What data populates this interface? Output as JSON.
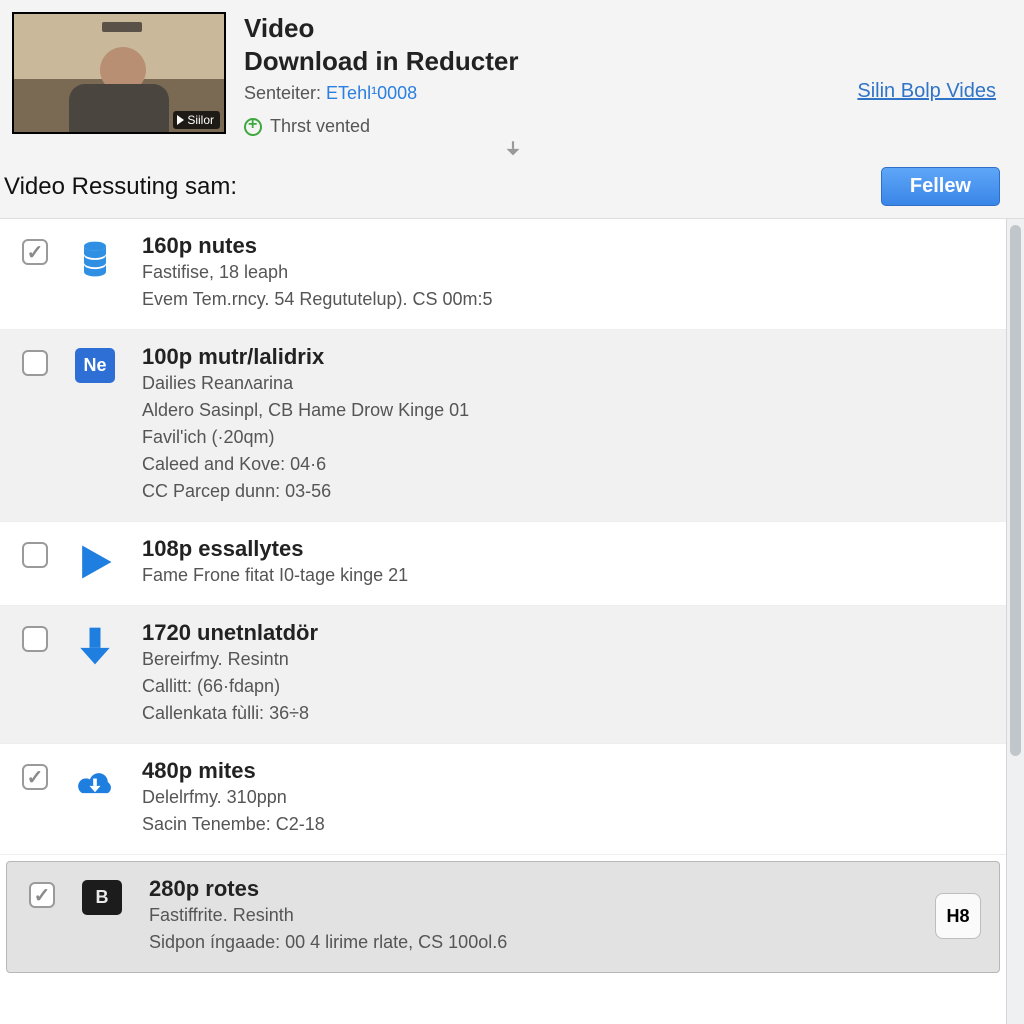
{
  "header": {
    "title_line1": "Video",
    "title_line2": "Download in Reducter",
    "sender_label": "Senteiter: ",
    "sender_link": "ETehl¹0008",
    "verified_text": "Thrst vented",
    "thumb_button": "Siilor",
    "sign_link": "Silin Bolp Vides"
  },
  "section": {
    "title": "Video Ressuting sam:",
    "follow_button": "Fellew"
  },
  "rows": [
    {
      "checked": true,
      "icon": "db-stack",
      "title": "160p nutes",
      "lines": [
        "Fastifise, 18 leaph",
        "Evem Tem.rncy. 54 Regututelup). CS 00m:5"
      ]
    },
    {
      "checked": false,
      "icon": "label-ne",
      "title": "100p mutr/lalidrix",
      "lines": [
        "Dailies Reanʌarina",
        "Aldero Sasinpl, CB  Hame Drow Kinge 01",
        "Favil'ich (·20qm)",
        "Caleed and Kove: 04·6",
        "CC Parcep dunn: 03-56"
      ]
    },
    {
      "checked": false,
      "icon": "play-tri",
      "title": "108p essallytes",
      "lines": [
        "Fame Frone fitat I0-tage kinge 21"
      ]
    },
    {
      "checked": false,
      "icon": "arrow-down",
      "title": "1720 unetnlatdör",
      "lines": [
        "Bereirfmy. Resintn",
        "Callitt: (66·fdapn)",
        "Callenkata fùlli: 36÷8"
      ]
    },
    {
      "checked": true,
      "icon": "cloud-dl",
      "title": "480p mites",
      "lines": [
        "Delelrfmy. 310ppn",
        "Sacin Tenembe: C2-18"
      ]
    },
    {
      "checked": true,
      "selected": true,
      "icon": "label-b",
      "title": "280p rotes",
      "lines": [
        "Fastiffrite. Resinth",
        "Sidpon íngaade: 00 4 lirime rlate, CS 100ol.6"
      ],
      "right_button": "H8"
    }
  ]
}
